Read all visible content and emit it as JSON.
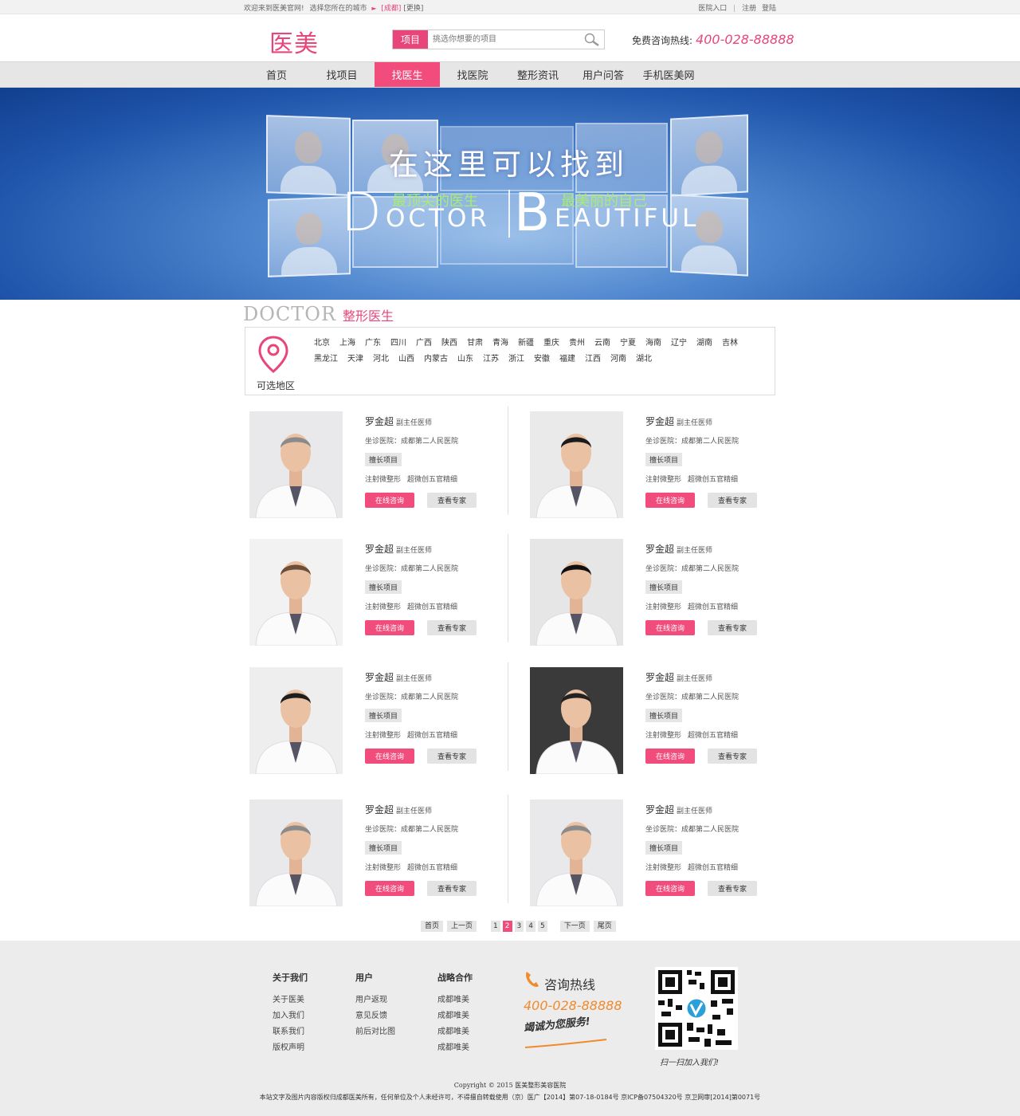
{
  "topbar": {
    "welcome": "欢迎来到医美官网!",
    "choose_city": "选择您所在的城市",
    "city": "[成都]",
    "switch": "[更换]",
    "hospital_entry": "医院入口",
    "register": "注册",
    "login": "登陆"
  },
  "header": {
    "logo": "医美",
    "search_tag": "项目",
    "search_placeholder": "挑选你想要的项目",
    "hotline_label": "免费咨询热线:",
    "hotline_number": "400-028-88888"
  },
  "nav": {
    "items": [
      "首页",
      "找项目",
      "找医生",
      "找医院",
      "整形资讯",
      "用户问答",
      "手机医美网"
    ],
    "active_index": 2
  },
  "banner": {
    "title": "在这里可以找到",
    "d_letter": "D",
    "d_rest": "OCTOR",
    "b_letter": "B",
    "b_rest": "EAUTIFUL",
    "tag_left": "最顶尖的医生",
    "tag_right": "最美丽的自己"
  },
  "section": {
    "title_en": "DOCTOR",
    "title_cn": "整形医生"
  },
  "region": {
    "label": "可选地区",
    "cities": [
      "北京",
      "上海",
      "广东",
      "四川",
      "广西",
      "陕西",
      "甘肃",
      "青海",
      "新疆",
      "重庆",
      "贵州",
      "云南",
      "宁夏",
      "海南",
      "辽宁",
      "湖南",
      "吉林",
      "黑龙江",
      "天津",
      "河北",
      "山西",
      "内蒙古",
      "山东",
      "江苏",
      "浙江",
      "安徽",
      "福建",
      "江西",
      "河南",
      "湖北"
    ]
  },
  "doctors": [
    {
      "name": "罗金超",
      "title": "副主任医师",
      "hospital": "坐诊医院：成都第二人民医院",
      "skill_tag": "擅长项目",
      "skills": [
        "注射微整形",
        "超微创五官精细"
      ],
      "consult": "在线咨询",
      "view": "查看专家"
    },
    {
      "name": "罗金超",
      "title": "副主任医师",
      "hospital": "坐诊医院：成都第二人民医院",
      "skill_tag": "擅长项目",
      "skills": [
        "注射微整形",
        "超微创五官精细"
      ],
      "consult": "在线咨询",
      "view": "查看专家"
    },
    {
      "name": "罗金超",
      "title": "副主任医师",
      "hospital": "坐诊医院：成都第二人民医院",
      "skill_tag": "擅长项目",
      "skills": [
        "注射微整形",
        "超微创五官精细"
      ],
      "consult": "在线咨询",
      "view": "查看专家"
    },
    {
      "name": "罗金超",
      "title": "副主任医师",
      "hospital": "坐诊医院：成都第二人民医院",
      "skill_tag": "擅长项目",
      "skills": [
        "注射微整形",
        "超微创五官精细"
      ],
      "consult": "在线咨询",
      "view": "查看专家"
    },
    {
      "name": "罗金超",
      "title": "副主任医师",
      "hospital": "坐诊医院：成都第二人民医院",
      "skill_tag": "擅长项目",
      "skills": [
        "注射微整形",
        "超微创五官精细"
      ],
      "consult": "在线咨询",
      "view": "查看专家"
    },
    {
      "name": "罗金超",
      "title": "副主任医师",
      "hospital": "坐诊医院：成都第二人民医院",
      "skill_tag": "擅长项目",
      "skills": [
        "注射微整形",
        "超微创五官精细"
      ],
      "consult": "在线咨询",
      "view": "查看专家"
    },
    {
      "name": "罗金超",
      "title": "副主任医师",
      "hospital": "坐诊医院：成都第二人民医院",
      "skill_tag": "擅长项目",
      "skills": [
        "注射微整形",
        "超微创五官精细"
      ],
      "consult": "在线咨询",
      "view": "查看专家"
    },
    {
      "name": "罗金超",
      "title": "副主任医师",
      "hospital": "坐诊医院：成都第二人民医院",
      "skill_tag": "擅长项目",
      "skills": [
        "注射微整形",
        "超微创五官精细"
      ],
      "consult": "在线咨询",
      "view": "查看专家"
    }
  ],
  "pager": {
    "first": "首页",
    "prev": "上一页",
    "pages": [
      "1",
      "2",
      "3",
      "4",
      "5"
    ],
    "current": "2",
    "next": "下一页",
    "last": "尾页"
  },
  "footer": {
    "cols": [
      {
        "title": "关于我们",
        "links": [
          "关于医美",
          "加入我们",
          "联系我们",
          "版权声明"
        ]
      },
      {
        "title": "用户",
        "links": [
          "用户返现",
          "意见反馈",
          "前后对比图"
        ]
      },
      {
        "title": "战略合作",
        "links": [
          "成都唯美",
          "成都唯美",
          "成都唯美",
          "成都唯美"
        ]
      }
    ],
    "hotline_title": "咨询热线",
    "hotline_number": "400-028-88888",
    "slogan": "竭诚为您服务!",
    "qr_caption": "扫一扫加入我们!",
    "copyright": "Copyright © 2015 医美整形美容医院",
    "legal": "本站文字及图片内容版权归成都医美所有，任何单位及个人未经许可，不得擅自转载使用（京）医广【2014】第07-18-0184号   京ICP备07504320号   京卫网审[2014]第0071号"
  },
  "colors": {
    "brand": "#e8467a",
    "nav_active": "#f14c7c",
    "hotline_orange": "#f08a2c"
  }
}
